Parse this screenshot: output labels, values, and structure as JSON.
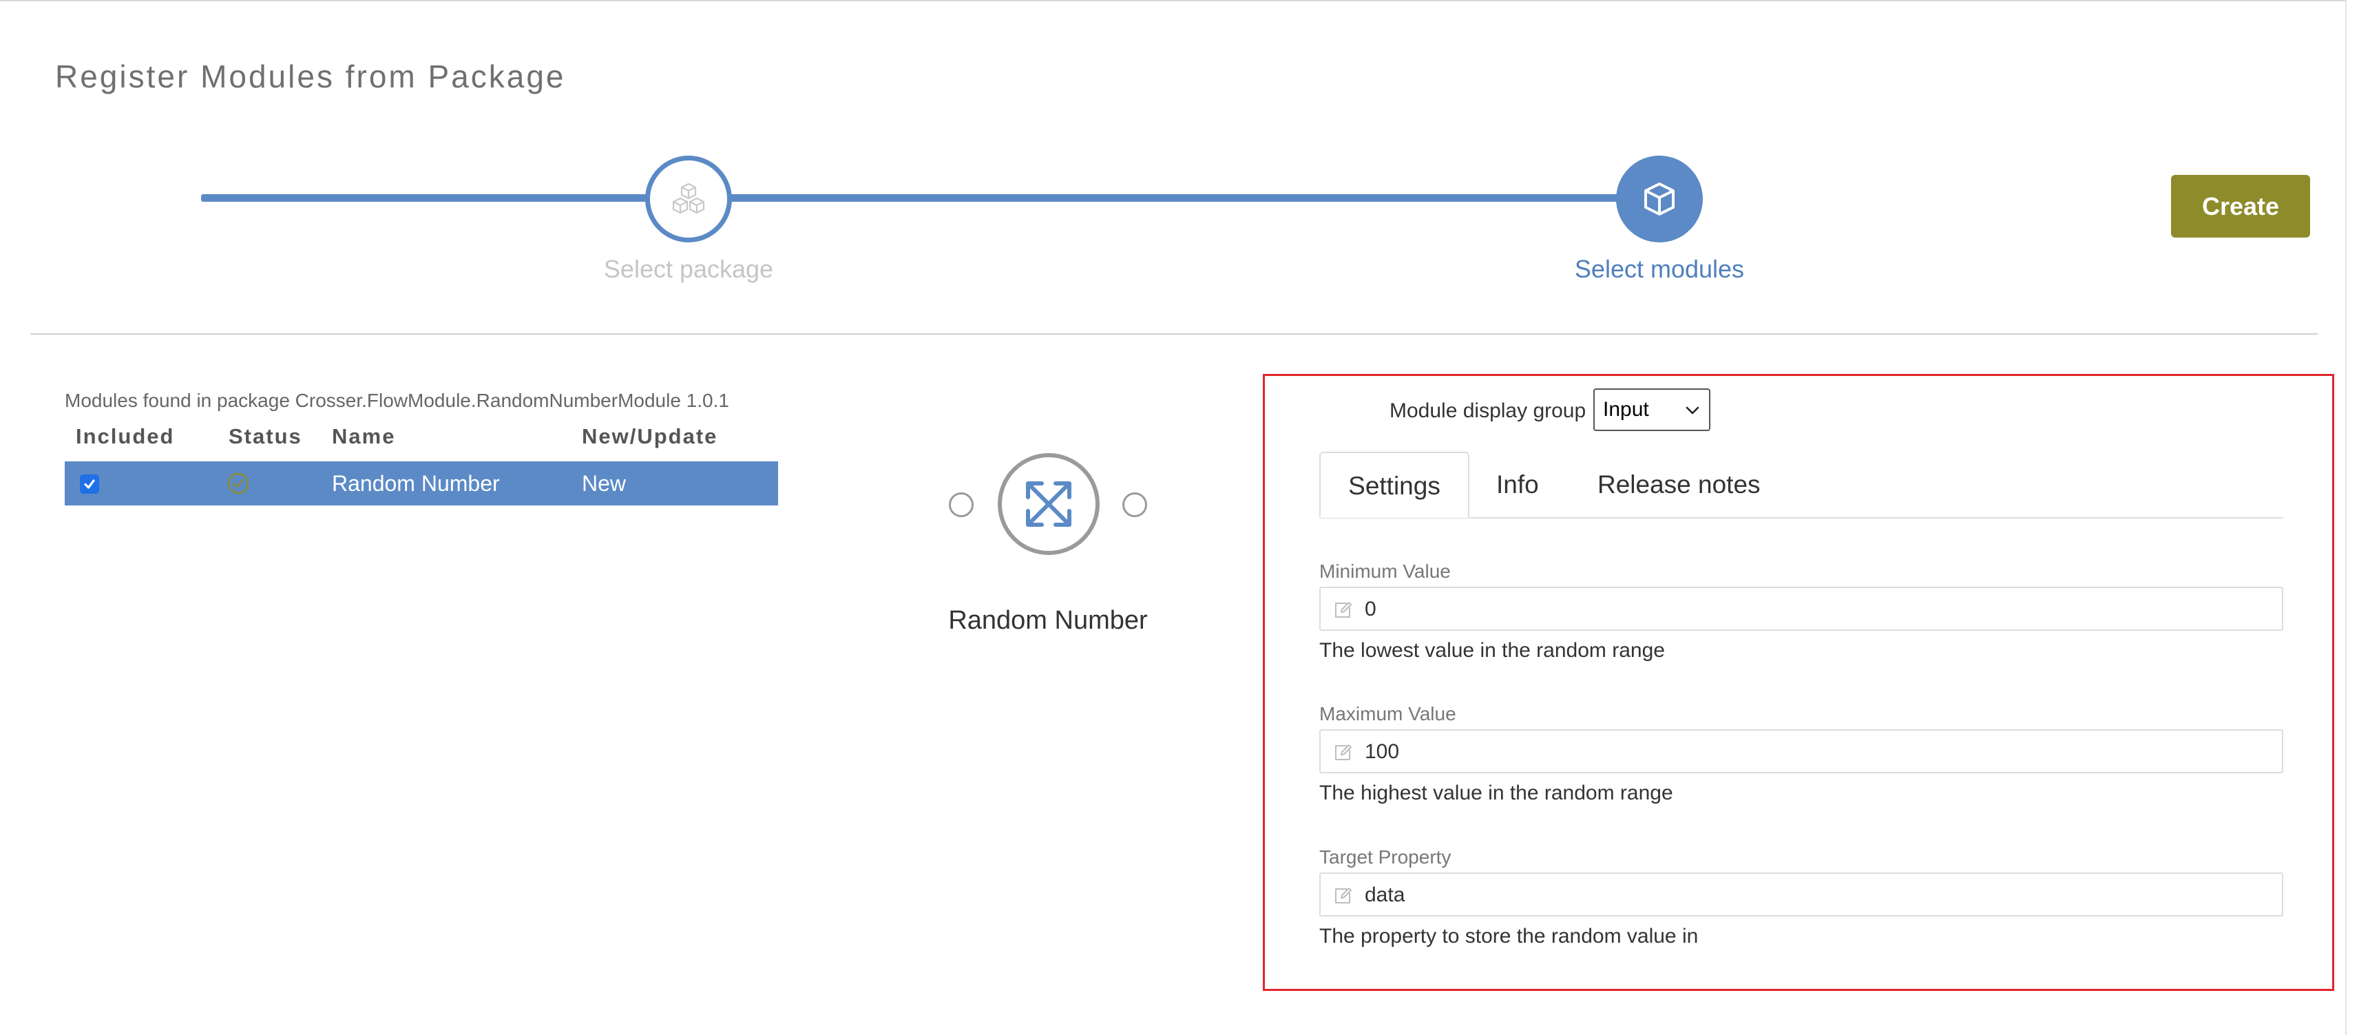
{
  "page": {
    "title": "Register Modules from Package"
  },
  "stepper": {
    "steps": [
      {
        "label": "Select package",
        "icon": "cubes-icon",
        "state": "completed"
      },
      {
        "label": "Select modules",
        "icon": "cube-icon",
        "state": "active"
      }
    ]
  },
  "actions": {
    "create_label": "Create"
  },
  "modules": {
    "caption": "Modules found in package Crosser.FlowModule.RandomNumberModule 1.0.1",
    "columns": [
      "Included",
      "Status",
      "Name",
      "New/Update"
    ],
    "rows": [
      {
        "included": true,
        "status": "check-circle-icon",
        "name": "Random Number",
        "new_update": "New"
      }
    ]
  },
  "preview": {
    "module_name": "Random Number",
    "icon": "shuffle-icon"
  },
  "settings": {
    "display_group_label": "Module display group",
    "display_group_value": "Input",
    "tabs": [
      "Settings",
      "Info",
      "Release notes"
    ],
    "active_tab": "Settings",
    "fields": [
      {
        "label": "Minimum Value",
        "value": "0",
        "help": "The lowest value in the random range"
      },
      {
        "label": "Maximum Value",
        "value": "100",
        "help": "The highest value in the random range"
      },
      {
        "label": "Target Property",
        "value": "data",
        "help": "The property to store the random value in"
      }
    ]
  },
  "colors": {
    "accent": "#5b8ac6",
    "create": "#8e8b2b",
    "highlight_border": "#e0262b"
  }
}
